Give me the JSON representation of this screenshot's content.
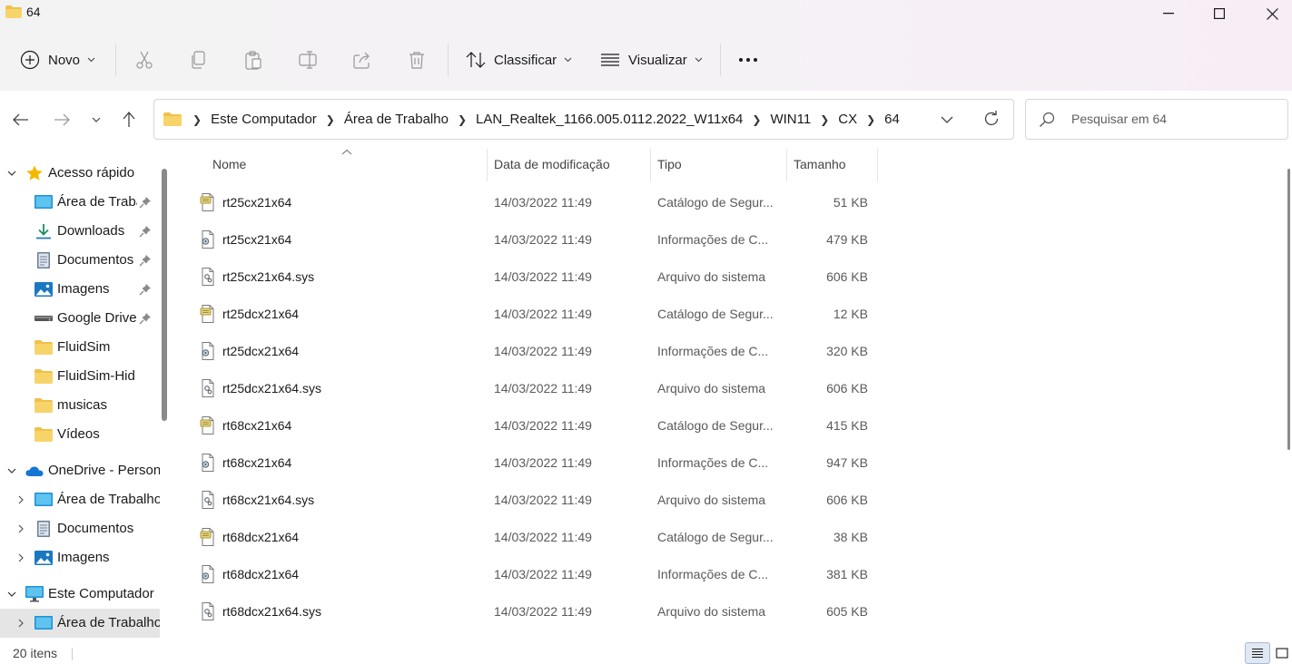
{
  "window": {
    "title": "64"
  },
  "toolbar": {
    "new_label": "Novo",
    "sort_label": "Classificar",
    "view_label": "Visualizar",
    "more_label": "..."
  },
  "address": {
    "breadcrumbs": [
      "Este Computador",
      "Área de Trabalho",
      "LAN_Realtek_1166.005.0112.2022_W11x64",
      "WIN11",
      "CX",
      "64"
    ],
    "search_placeholder": "Pesquisar em 64"
  },
  "nav": {
    "items": [
      {
        "label": "Acesso rápido",
        "icon": "star-icon",
        "pinned": false
      },
      {
        "label": "Área de Trabalho",
        "icon": "desktop-icon",
        "pinned": true
      },
      {
        "label": "Downloads",
        "icon": "download-icon",
        "pinned": true
      },
      {
        "label": "Documentos",
        "icon": "document-icon",
        "pinned": true
      },
      {
        "label": "Imagens",
        "icon": "image-icon",
        "pinned": true
      },
      {
        "label": "Google Drive",
        "icon": "drive-icon",
        "pinned": true
      },
      {
        "label": "FluidSim",
        "icon": "folder-icon",
        "pinned": false
      },
      {
        "label": "FluidSim-Hid",
        "icon": "folder-icon",
        "pinned": false
      },
      {
        "label": "musicas",
        "icon": "folder-icon",
        "pinned": false
      },
      {
        "label": "Vídeos",
        "icon": "folder-icon",
        "pinned": false
      },
      {
        "label": "OneDrive - Person",
        "icon": "cloud-icon",
        "pinned": false
      },
      {
        "label": "Área de Trabalho",
        "icon": "desktop-icon",
        "pinned": false
      },
      {
        "label": "Documentos",
        "icon": "document-icon",
        "pinned": false
      },
      {
        "label": "Imagens",
        "icon": "image-icon",
        "pinned": false
      },
      {
        "label": "Este Computador",
        "icon": "computer-icon",
        "pinned": false
      },
      {
        "label": "Área de Trabalho",
        "icon": "desktop-icon",
        "pinned": false
      }
    ]
  },
  "columns": {
    "name": "Nome",
    "date": "Data de modificação",
    "type": "Tipo",
    "size": "Tamanho"
  },
  "files": [
    {
      "name": "rt25cx21x64",
      "date": "14/03/2022 11:49",
      "type": "Catálogo de Segur...",
      "size": "51 KB",
      "kind": "cat"
    },
    {
      "name": "rt25cx21x64",
      "date": "14/03/2022 11:49",
      "type": "Informações de C...",
      "size": "479 KB",
      "kind": "inf"
    },
    {
      "name": "rt25cx21x64.sys",
      "date": "14/03/2022 11:49",
      "type": "Arquivo do sistema",
      "size": "606 KB",
      "kind": "sys"
    },
    {
      "name": "rt25dcx21x64",
      "date": "14/03/2022 11:49",
      "type": "Catálogo de Segur...",
      "size": "12 KB",
      "kind": "cat"
    },
    {
      "name": "rt25dcx21x64",
      "date": "14/03/2022 11:49",
      "type": "Informações de C...",
      "size": "320 KB",
      "kind": "inf"
    },
    {
      "name": "rt25dcx21x64.sys",
      "date": "14/03/2022 11:49",
      "type": "Arquivo do sistema",
      "size": "606 KB",
      "kind": "sys"
    },
    {
      "name": "rt68cx21x64",
      "date": "14/03/2022 11:49",
      "type": "Catálogo de Segur...",
      "size": "415 KB",
      "kind": "cat"
    },
    {
      "name": "rt68cx21x64",
      "date": "14/03/2022 11:49",
      "type": "Informações de C...",
      "size": "947 KB",
      "kind": "inf"
    },
    {
      "name": "rt68cx21x64.sys",
      "date": "14/03/2022 11:49",
      "type": "Arquivo do sistema",
      "size": "606 KB",
      "kind": "sys"
    },
    {
      "name": "rt68dcx21x64",
      "date": "14/03/2022 11:49",
      "type": "Catálogo de Segur...",
      "size": "38 KB",
      "kind": "cat"
    },
    {
      "name": "rt68dcx21x64",
      "date": "14/03/2022 11:49",
      "type": "Informações de C...",
      "size": "381 KB",
      "kind": "inf"
    },
    {
      "name": "rt68dcx21x64.sys",
      "date": "14/03/2022 11:49",
      "type": "Arquivo do sistema",
      "size": "605 KB",
      "kind": "sys"
    }
  ],
  "status": {
    "item_count": "20 itens"
  },
  "colors": {
    "folder": "#f0c14a",
    "accent": "#0067c0",
    "selected_nav": "#e5e5e5"
  }
}
